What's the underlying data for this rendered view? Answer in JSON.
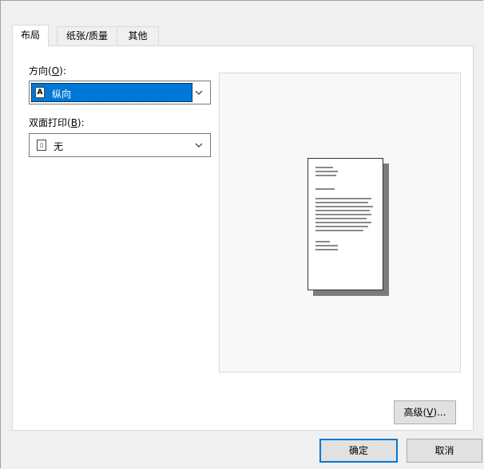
{
  "tabs": [
    {
      "label": "布局",
      "active": true
    },
    {
      "label": "纸张/质量",
      "active": false
    },
    {
      "label": "其他",
      "active": false
    }
  ],
  "orientation": {
    "label_prefix": "方向(",
    "label_key": "O",
    "label_suffix": "):",
    "value": "纵向",
    "icon": "A"
  },
  "duplex": {
    "label_prefix": "双面打印(",
    "label_key": "B",
    "label_suffix": "):",
    "value": "无"
  },
  "buttons": {
    "advanced_prefix": "高级(",
    "advanced_key": "V",
    "advanced_suffix": ")...",
    "ok": "确定",
    "cancel": "取消"
  },
  "colors": {
    "accent": "#0078d7",
    "background": "#f0f0f0"
  }
}
